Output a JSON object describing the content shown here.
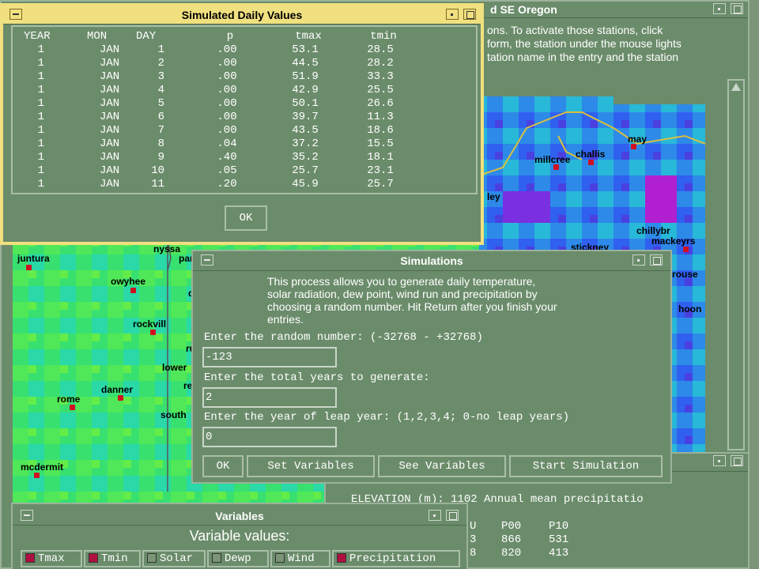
{
  "map_window": {
    "title_fragment": "d SE Oregon",
    "instructions": [
      "ons. To activate those stations, click",
      "form, the station under the mouse lights",
      "tation name in the entry and the station"
    ]
  },
  "stations": [
    "may",
    "challis",
    "millcree",
    "ley",
    "chillybr",
    "mackeyrs",
    "stickney",
    "rouse",
    "hoon",
    "nyssa",
    "par",
    "juntura",
    "owyhee",
    "rockvill",
    "d",
    "ru",
    "lower",
    "re",
    "rome",
    "danner",
    "south",
    "mcdermit"
  ],
  "daily_window": {
    "title": "Simulated Daily Values",
    "headers": [
      "YEAR",
      "MON",
      "DAY",
      "p",
      "tmax",
      "tmin"
    ],
    "rows": [
      [
        "1",
        "JAN",
        "1",
        ".00",
        "53.1",
        "28.5"
      ],
      [
        "1",
        "JAN",
        "2",
        ".00",
        "44.5",
        "28.2"
      ],
      [
        "1",
        "JAN",
        "3",
        ".00",
        "51.9",
        "33.3"
      ],
      [
        "1",
        "JAN",
        "4",
        ".00",
        "42.9",
        "25.5"
      ],
      [
        "1",
        "JAN",
        "5",
        ".00",
        "50.1",
        "26.6"
      ],
      [
        "1",
        "JAN",
        "6",
        ".00",
        "39.7",
        "11.3"
      ],
      [
        "1",
        "JAN",
        "7",
        ".00",
        "43.5",
        "18.6"
      ],
      [
        "1",
        "JAN",
        "8",
        ".04",
        "37.2",
        "15.5"
      ],
      [
        "1",
        "JAN",
        "9",
        ".40",
        "35.2",
        "18.1"
      ],
      [
        "1",
        "JAN",
        "10",
        ".05",
        "25.7",
        "23.1"
      ],
      [
        "1",
        "JAN",
        "11",
        ".20",
        "45.9",
        "25.7"
      ]
    ],
    "ok_label": "OK"
  },
  "simulations_window": {
    "title": "Simulations",
    "description": [
      "This process allows you to generate daily temperature,",
      "solar radiation, dew point, wind run and precipitation by",
      "choosing a random number. Hit Return after you finish your",
      "entries."
    ],
    "random_label": "Enter the random number: (-32768 - +32768)",
    "random_value": "-123",
    "years_label": "Enter the total years to generate:",
    "years_value": "2",
    "leap_label": "Enter the year of leap year: (1,2,3,4; 0-no leap years)",
    "leap_value": "0",
    "buttons": [
      "OK",
      "Set Variables",
      "See Variables",
      "Start Simulation"
    ]
  },
  "station_info_window": {
    "elevation_line": "ELEVATION (m): 1102  Annual mean precipitatio",
    "headers": [
      "U",
      "P00",
      "P10"
    ],
    "rows": [
      [
        "3",
        "866",
        "531"
      ],
      [
        "8",
        "820",
        "413"
      ]
    ]
  },
  "variables_window": {
    "title": "Variables",
    "heading": "Variable values:",
    "checks": [
      {
        "label": "Tmax",
        "checked": true
      },
      {
        "label": "Tmin",
        "checked": true
      },
      {
        "label": "Solar",
        "checked": false
      },
      {
        "label": "Dewp",
        "checked": false
      },
      {
        "label": "Wind",
        "checked": false
      },
      {
        "label": "Precipitation",
        "checked": true
      }
    ]
  },
  "colors": {
    "window_bg": "#6b8c6b",
    "active_title": "#f0e080",
    "station_marker": "#d01020"
  }
}
